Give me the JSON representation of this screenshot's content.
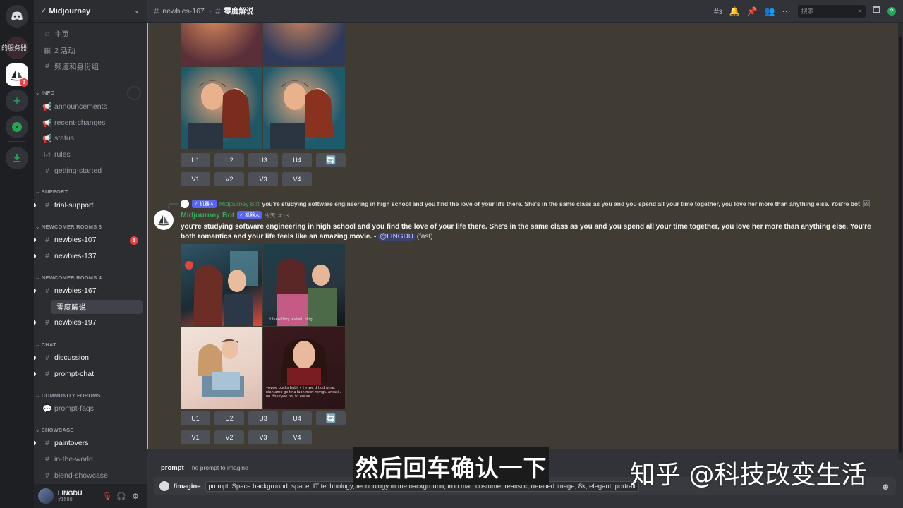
{
  "server": {
    "name": "Midjourney",
    "rail_label": "的服务器",
    "rail_badge": "1"
  },
  "sidebar": {
    "top": [
      {
        "icon": "home-icon",
        "label": "主页"
      },
      {
        "icon": "calendar-icon",
        "label": "2 活动"
      },
      {
        "icon": "channels-icon",
        "label": "频道和身份组"
      }
    ],
    "categories": {
      "info": "INFO",
      "support": "SUPPORT",
      "newcomer3": "NEWCOMER ROOMS 3",
      "newcomer4": "NEWCOMER ROOMS 4",
      "chat": "CHAT",
      "forums": "COMMUNITY FORUMS",
      "showcase": "SHOWCASE"
    },
    "channels": {
      "announcements": "announcements",
      "recent_changes": "recent-changes",
      "status": "status",
      "rules": "rules",
      "getting_started": "getting-started",
      "trial_support": "trial-support",
      "newbies_107": "newbies-107",
      "newbies_107_badge": "1",
      "newbies_137": "newbies-137",
      "newbies_167": "newbies-167",
      "thread": "零度解说",
      "newbies_197": "newbies-197",
      "discussion": "discussion",
      "prompt_chat": "prompt-chat",
      "prompt_faqs": "prompt-faqs",
      "paintovers": "paintovers",
      "in_the_world": "in-the-world",
      "blend_showcase": "blend-showcase"
    }
  },
  "user": {
    "name": "LINGDU",
    "tag": "#1588"
  },
  "header": {
    "channel": "newbies-167",
    "thread": "零度解说",
    "thread_count": "3",
    "search_placeholder": "搜索"
  },
  "upscale_buttons": [
    "U1",
    "U2",
    "U3",
    "U4"
  ],
  "variation_buttons": [
    "V1",
    "V2",
    "V3",
    "V4"
  ],
  "message": {
    "reply_tag": "✓ 机器人",
    "reply_name": "Midjourney Bot",
    "reply_text": "you're studying software engineering in high school and you find the love of your life there. She's in the same class as you and you spend all your time together, you love her more than anything else. You're bot",
    "author": "Midjourney Bot",
    "bot_tag": "✓ 机器人",
    "timestamp": "今天14:13",
    "content": "you're studying software engineering in high school and you find the love of your life there. She's in the same class as you and you spend all your time together, you love her more than anything else. You're both romantics and your life feels like an amazing movie. - ",
    "mention": "@LINGDU",
    "mode": " (fast)",
    "image_caption": "vovwe pucks bubil y i mwe d tiod wine. nian amo ge tina laon mori remgs. arxasi.. uo. the ryoe ne. to eocae.",
    "image_small_text": "it Inewiltory levivel, blirg"
  },
  "composer": {
    "hint_key": "prompt",
    "hint_desc": "The prompt to imagine",
    "command": "/imagine",
    "option": "prompt",
    "value": "Space background, space, IT technology, technology in the background, iron man costume, realistic, detailed image, 8k, elegant, portrait"
  },
  "overlay": {
    "subtitle": "然后回车确认一下",
    "watermark": "知乎 @科技改变生活"
  },
  "colors": {
    "accent": "#f0b232",
    "bot_green": "#3ba55c",
    "blurple": "#5865f2",
    "bg": "#313338"
  }
}
